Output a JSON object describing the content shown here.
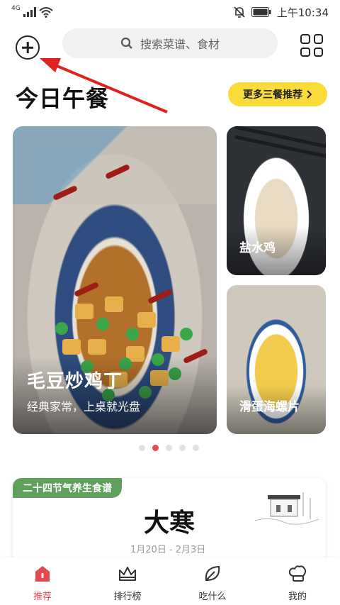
{
  "status_bar": {
    "network": "4G",
    "time": "上午10:34"
  },
  "header": {
    "search_placeholder": "搜索菜谱、食材"
  },
  "section": {
    "title": "今日午餐",
    "more_label": "更多三餐推荐"
  },
  "cards": {
    "main": {
      "name": "毛豆炒鸡丁",
      "subtitle": "经典家常，上桌就光盘"
    },
    "side1": {
      "name": "盐水鸡"
    },
    "side2": {
      "name": "滑蛋海螺片"
    }
  },
  "pager": {
    "count": 5,
    "active_index": 1
  },
  "solar_term": {
    "badge": "二十四节气养生食谱",
    "name": "大寒",
    "date_range": "1月20日 - 2月3日"
  },
  "bottom_nav": {
    "items": [
      {
        "label": "推荐",
        "icon": "home-icon",
        "active": true
      },
      {
        "label": "排行榜",
        "icon": "crown-icon",
        "active": false
      },
      {
        "label": "吃什么",
        "icon": "leaf-icon",
        "active": false
      },
      {
        "label": "我的",
        "icon": "chef-hat-icon",
        "active": false
      }
    ]
  },
  "colors": {
    "accent": "#e5484d",
    "highlight": "#f9dc3b",
    "badge_green": "#5fa15c"
  }
}
